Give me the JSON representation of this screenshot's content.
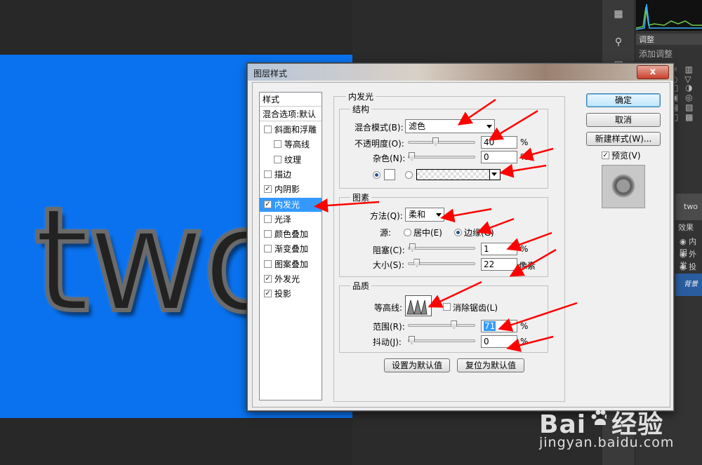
{
  "canvas": {
    "text": "two"
  },
  "right_panel": {
    "adjust_tab": "调整",
    "adjust_sub": "添加调整",
    "layer_name": "two",
    "effects_label": "效果",
    "effect_items": [
      "内阴",
      "外发",
      "投影"
    ],
    "background_layer": "背景"
  },
  "dialog": {
    "title": "图层样式",
    "close_symbol": "x",
    "styles_header": "样式",
    "blend_options": "混合选项:默认",
    "style_items": [
      {
        "label": "斜面和浮雕",
        "checked": false,
        "indent": false,
        "selected": false
      },
      {
        "label": "等高线",
        "checked": false,
        "indent": true,
        "selected": false
      },
      {
        "label": "纹理",
        "checked": false,
        "indent": true,
        "selected": false
      },
      {
        "label": "描边",
        "checked": false,
        "indent": false,
        "selected": false
      },
      {
        "label": "内阴影",
        "checked": true,
        "indent": false,
        "selected": false
      },
      {
        "label": "内发光",
        "checked": true,
        "indent": false,
        "selected": true
      },
      {
        "label": "光泽",
        "checked": false,
        "indent": false,
        "selected": false
      },
      {
        "label": "颜色叠加",
        "checked": false,
        "indent": false,
        "selected": false
      },
      {
        "label": "渐变叠加",
        "checked": false,
        "indent": false,
        "selected": false
      },
      {
        "label": "图案叠加",
        "checked": false,
        "indent": false,
        "selected": false
      },
      {
        "label": "外发光",
        "checked": true,
        "indent": false,
        "selected": false
      },
      {
        "label": "投影",
        "checked": true,
        "indent": false,
        "selected": false
      }
    ],
    "section_title": "内发光",
    "structure": {
      "legend": "结构",
      "blend_mode_label": "混合模式(B):",
      "blend_mode_value": "滤色",
      "opacity_label": "不透明度(O):",
      "opacity_value": "40",
      "noise_label": "杂色(N):",
      "noise_value": "0",
      "percent": "%"
    },
    "elements": {
      "legend": "图素",
      "method_label": "方法(Q):",
      "method_value": "柔和",
      "source_label": "源:",
      "source_center": "居中(E)",
      "source_edge": "边缘(G)",
      "choke_label": "阻塞(C):",
      "choke_value": "1",
      "size_label": "大小(S):",
      "size_value": "22",
      "size_unit": "像素"
    },
    "quality": {
      "legend": "品质",
      "contour_label": "等高线:",
      "antialias_label": "消除锯齿(L)",
      "range_label": "范围(R):",
      "range_value": "71",
      "jitter_label": "抖动(J):",
      "jitter_value": "0"
    },
    "buttons": {
      "make_default": "设置为默认值",
      "reset_default": "复位为默认值",
      "ok": "确定",
      "cancel": "取消",
      "new_style": "新建样式(W)...",
      "preview": "预览(V)"
    },
    "levels": {
      "opacity": 0.4,
      "noise": 0.0,
      "choke": 0.01,
      "size": 0.088,
      "range": 0.71,
      "jitter": 0.0
    }
  },
  "watermark": {
    "brand": "Bai",
    "brand2": "经验",
    "url": "jingyan.baidu.com"
  },
  "colors": {
    "canvas_blue": "#0a72ef",
    "selection": "#3399ff",
    "annotation_red": "#ff0000"
  }
}
